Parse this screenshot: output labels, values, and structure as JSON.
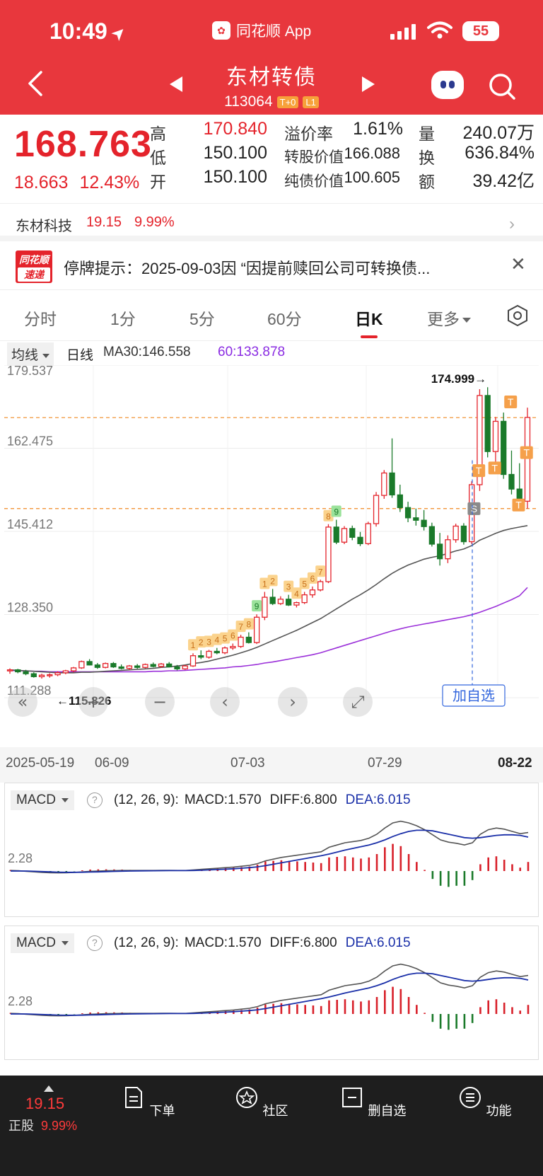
{
  "status": {
    "time": "10:49",
    "app_name": "同花顺 App",
    "battery": "55"
  },
  "header": {
    "title": "东材转债",
    "code": "113064",
    "tags": [
      "T+0",
      "L1"
    ]
  },
  "quote": {
    "price": "168.763",
    "change": "18.663",
    "change_pct": "12.43%",
    "high_label": "高",
    "high": "170.840",
    "low_label": "低",
    "low": "150.100",
    "open_label": "开",
    "open": "150.100",
    "premium_label": "溢价率",
    "premium": "1.61%",
    "conv_label": "转股价值",
    "conv": "166.088",
    "bond_label": "纯债价值",
    "bond": "100.605",
    "vol_label": "量",
    "vol": "240.07万",
    "turn_label": "换",
    "turn": "636.84%",
    "amt_label": "额",
    "amt": "39.42亿"
  },
  "underlying": {
    "name": "东材科技",
    "price": "19.15",
    "pct": "9.99%"
  },
  "notice": {
    "badge_top": "同花顺",
    "badge_bottom": "速递",
    "text": "停牌提示：2025-09-03因 “因提前赎回公司可转换债..."
  },
  "tabs": [
    "分时",
    "1分",
    "5分",
    "60分",
    "日K",
    "更多"
  ],
  "active_tab": "日K",
  "ma": {
    "select": "均线",
    "period": "日线",
    "ma30": "MA30:146.558",
    "ma60": "60:133.878"
  },
  "chart_controls": {
    "add_watch": "加自选"
  },
  "chart_data": {
    "type": "candlestick",
    "y_ticks": [
      "179.537",
      "162.475",
      "145.412",
      "128.350",
      "111.288"
    ],
    "ylim": [
      111.288,
      179.537
    ],
    "high_mark": "174.999→",
    "low_mark": "←115.826",
    "x_ticks": [
      "2025-05-19",
      "06-09",
      "07-03",
      "07-29",
      "08-22"
    ],
    "colors": {
      "up": "#e4232b",
      "down": "#1a7a2a",
      "ma30": "#555555",
      "ma60": "#9b30d9"
    },
    "candles": [
      [
        116.8,
        117.3,
        116.2,
        117.0
      ],
      [
        117.0,
        117.2,
        116.3,
        116.6
      ],
      [
        116.6,
        117.0,
        115.9,
        116.2
      ],
      [
        116.2,
        116.5,
        115.4,
        115.6
      ],
      [
        115.6,
        116.2,
        115.2,
        115.9
      ],
      [
        115.9,
        116.3,
        115.4,
        116.0
      ],
      [
        116.0,
        116.7,
        115.7,
        116.4
      ],
      [
        116.4,
        117.0,
        116.1,
        116.8
      ],
      [
        116.8,
        117.6,
        116.5,
        117.4
      ],
      [
        117.4,
        118.9,
        117.2,
        118.7
      ],
      [
        118.7,
        119.2,
        117.9,
        118.0
      ],
      [
        118.0,
        118.4,
        117.2,
        117.5
      ],
      [
        117.5,
        118.5,
        117.3,
        118.3
      ],
      [
        118.3,
        118.6,
        117.4,
        117.6
      ],
      [
        117.6,
        118.1,
        117.1,
        117.3
      ],
      [
        117.3,
        118.0,
        117.0,
        117.8
      ],
      [
        117.8,
        118.2,
        117.2,
        117.5
      ],
      [
        117.5,
        118.3,
        117.3,
        118.1
      ],
      [
        118.1,
        118.5,
        117.5,
        117.7
      ],
      [
        117.7,
        118.4,
        117.4,
        118.2
      ],
      [
        118.2,
        118.6,
        117.5,
        117.6
      ],
      [
        117.6,
        118.0,
        116.9,
        117.2
      ],
      [
        117.2,
        118.0,
        117.0,
        117.8
      ],
      [
        117.8,
        120.4,
        117.6,
        119.9
      ],
      [
        119.9,
        121.0,
        119.2,
        119.6
      ],
      [
        119.6,
        121.1,
        119.3,
        120.8
      ],
      [
        120.8,
        121.5,
        120.2,
        120.5
      ],
      [
        120.5,
        121.8,
        120.2,
        121.5
      ],
      [
        121.5,
        122.4,
        121.1,
        121.8
      ],
      [
        121.8,
        124.2,
        121.5,
        123.7
      ],
      [
        123.7,
        124.7,
        122.4,
        122.6
      ],
      [
        122.6,
        128.4,
        122.3,
        127.8
      ],
      [
        127.8,
        133.0,
        127.2,
        131.9
      ],
      [
        131.9,
        133.6,
        130.3,
        130.6
      ],
      [
        130.6,
        132.1,
        130.3,
        131.5
      ],
      [
        131.5,
        132.4,
        130.1,
        130.3
      ],
      [
        130.3,
        131.0,
        129.8,
        130.8
      ],
      [
        130.8,
        133.0,
        130.5,
        132.4
      ],
      [
        132.4,
        134.1,
        131.8,
        133.4
      ],
      [
        133.4,
        135.5,
        133.1,
        135.1
      ],
      [
        135.1,
        146.9,
        134.8,
        146.3
      ],
      [
        146.3,
        147.8,
        142.8,
        143.2
      ],
      [
        143.2,
        146.5,
        142.8,
        146.0
      ],
      [
        146.0,
        146.6,
        143.6,
        144.2
      ],
      [
        144.2,
        145.3,
        142.4,
        142.9
      ],
      [
        142.9,
        147.4,
        142.6,
        147.0
      ],
      [
        147.0,
        153.5,
        146.4,
        152.8
      ],
      [
        152.8,
        158.0,
        152.1,
        157.4
      ],
      [
        157.4,
        164.5,
        152.3,
        152.9
      ],
      [
        152.9,
        155.0,
        149.4,
        150.3
      ],
      [
        150.3,
        151.5,
        147.3,
        148.2
      ],
      [
        148.2,
        150.1,
        146.6,
        147.7
      ],
      [
        147.7,
        149.8,
        145.6,
        146.4
      ],
      [
        146.4,
        147.2,
        142.3,
        142.8
      ],
      [
        142.8,
        145.1,
        138.4,
        139.8
      ],
      [
        139.8,
        144.6,
        138.9,
        143.7
      ],
      [
        143.7,
        147.0,
        143.1,
        146.5
      ],
      [
        146.5,
        147.1,
        142.7,
        143.3
      ],
      [
        143.3,
        155.7,
        142.8,
        155.0
      ],
      [
        155.0,
        174.6,
        153.7,
        173.3
      ],
      [
        173.3,
        175.0,
        160.6,
        161.8
      ],
      [
        161.8,
        168.9,
        158.2,
        168.0
      ],
      [
        168.0,
        169.8,
        156.2,
        157.1
      ],
      [
        157.1,
        162.0,
        153.0,
        154.1
      ],
      [
        154.1,
        159.4,
        150.4,
        151.6
      ],
      [
        151.6,
        170.8,
        150.1,
        168.8
      ]
    ],
    "ma30": [
      117.0,
      116.9,
      116.8,
      116.7,
      116.6,
      116.5,
      116.4,
      116.4,
      116.4,
      116.5,
      116.5,
      116.6,
      116.7,
      116.8,
      116.9,
      117.0,
      117.1,
      117.2,
      117.3,
      117.5,
      117.6,
      117.8,
      118.0,
      118.3,
      118.5,
      118.8,
      119.2,
      119.6,
      120.0,
      120.5,
      121.0,
      121.6,
      122.3,
      123.0,
      123.7,
      124.4,
      125.1,
      125.9,
      126.7,
      127.5,
      128.5,
      129.5,
      130.5,
      131.5,
      132.4,
      133.4,
      134.5,
      135.7,
      136.8,
      137.7,
      138.5,
      139.1,
      139.7,
      140.1,
      140.4,
      140.9,
      141.4,
      141.8,
      142.5,
      143.6,
      144.3,
      145.0,
      145.6,
      146.0,
      146.3,
      146.6
    ],
    "ma60": [
      116.9,
      116.8,
      116.8,
      116.7,
      116.7,
      116.6,
      116.6,
      116.6,
      116.6,
      116.6,
      116.6,
      116.6,
      116.6,
      116.6,
      116.6,
      116.6,
      116.6,
      116.6,
      116.7,
      116.7,
      116.8,
      116.8,
      116.9,
      117.0,
      117.1,
      117.2,
      117.3,
      117.4,
      117.6,
      117.7,
      117.9,
      118.1,
      118.4,
      118.6,
      118.9,
      119.2,
      119.5,
      119.8,
      120.1,
      120.5,
      121.0,
      121.5,
      122.0,
      122.5,
      123.0,
      123.5,
      124.0,
      124.5,
      125.0,
      125.4,
      125.8,
      126.1,
      126.4,
      126.7,
      127.0,
      127.3,
      127.6,
      127.9,
      128.3,
      128.8,
      129.4,
      130.0,
      130.7,
      131.4,
      132.2,
      133.9
    ],
    "markers": [
      {
        "label": "1",
        "i": 23
      },
      {
        "label": "2",
        "i": 24
      },
      {
        "label": "3",
        "i": 25
      },
      {
        "label": "4",
        "i": 26
      },
      {
        "label": "5",
        "i": 27
      },
      {
        "label": "6",
        "i": 28
      },
      {
        "label": "7",
        "i": 29
      },
      {
        "label": "8",
        "i": 30
      },
      {
        "label": "9",
        "i": 31
      },
      {
        "label": "1",
        "i": 32
      },
      {
        "label": "2",
        "i": 33
      },
      {
        "label": "3",
        "i": 35
      },
      {
        "label": "4",
        "i": 36
      },
      {
        "label": "5",
        "i": 37
      },
      {
        "label": "6",
        "i": 38
      },
      {
        "label": "7",
        "i": 39
      },
      {
        "label": "8",
        "i": 40
      },
      {
        "label": "9",
        "i": 41
      }
    ],
    "t_markers": [
      58,
      60,
      62,
      63,
      64
    ],
    "s_markers": [
      59
    ]
  },
  "macd": {
    "select": "MACD",
    "params": "(12, 26, 9):",
    "macd_label": "MACD:1.570",
    "diff_label": "DIFF:6.800",
    "dea_label": "DEA:6.015",
    "y_tick": "2.28",
    "diff": [
      0.1,
      0.05,
      -0.05,
      -0.15,
      -0.25,
      -0.3,
      -0.32,
      -0.3,
      -0.25,
      -0.15,
      -0.05,
      0.0,
      0.05,
      0.08,
      0.1,
      0.1,
      0.1,
      0.1,
      0.1,
      0.12,
      0.12,
      0.1,
      0.1,
      0.2,
      0.3,
      0.4,
      0.5,
      0.6,
      0.7,
      0.85,
      1.0,
      1.3,
      1.8,
      2.1,
      2.4,
      2.6,
      2.8,
      3.0,
      3.2,
      3.4,
      4.2,
      4.6,
      5.0,
      5.2,
      5.4,
      5.8,
      6.5,
      7.6,
      8.5,
      8.8,
      8.5,
      8.0,
      7.3,
      6.4,
      5.5,
      5.1,
      4.9,
      4.6,
      5.0,
      6.5,
      7.3,
      7.6,
      7.4,
      7.0,
      6.6,
      6.8
    ],
    "dea": [
      0.0,
      0.0,
      0.0,
      -0.05,
      -0.1,
      -0.15,
      -0.2,
      -0.22,
      -0.23,
      -0.21,
      -0.18,
      -0.15,
      -0.1,
      -0.06,
      -0.03,
      0.0,
      0.02,
      0.04,
      0.05,
      0.06,
      0.07,
      0.08,
      0.08,
      0.1,
      0.14,
      0.2,
      0.26,
      0.33,
      0.4,
      0.5,
      0.6,
      0.74,
      0.95,
      1.2,
      1.45,
      1.7,
      1.95,
      2.2,
      2.45,
      2.7,
      3.0,
      3.35,
      3.7,
      4.0,
      4.3,
      4.6,
      5.0,
      5.5,
      6.1,
      6.6,
      7.0,
      7.2,
      7.2,
      7.1,
      6.8,
      6.5,
      6.2,
      5.9,
      5.8,
      5.9,
      6.1,
      6.3,
      6.4,
      6.4,
      6.3,
      6.0
    ]
  },
  "bottom_nav": {
    "stock_price": "19.15",
    "stock_label": "正股",
    "stock_pct": "9.99%",
    "items": [
      "下单",
      "社区",
      "删自选",
      "功能"
    ]
  }
}
